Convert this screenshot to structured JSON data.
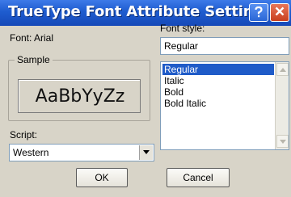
{
  "window": {
    "title": "TrueType Font Attribute Setting",
    "help_label": "?",
    "close_label": "X"
  },
  "font": {
    "label": "Font: Arial"
  },
  "sample": {
    "group_label": "Sample",
    "text": "AaBbYyZz"
  },
  "script": {
    "label": "Script:",
    "value": "Western"
  },
  "font_style": {
    "label": "Font style:",
    "value": "Regular",
    "options": [
      "Regular",
      "Italic",
      "Bold",
      "Bold Italic"
    ],
    "selected": "Regular"
  },
  "buttons": {
    "ok": "OK",
    "cancel": "Cancel"
  },
  "colors": {
    "title_bar": "#1e5ccf",
    "selection": "#1f5bc8",
    "close_button": "#c9401e",
    "dialog_bg": "#d8d4c8"
  },
  "icons": {
    "help": "help-icon",
    "close": "close-icon",
    "dropdown": "chevron-down-icon",
    "scroll_up": "scroll-up-arrow-icon",
    "scroll_down": "scroll-down-arrow-icon"
  }
}
